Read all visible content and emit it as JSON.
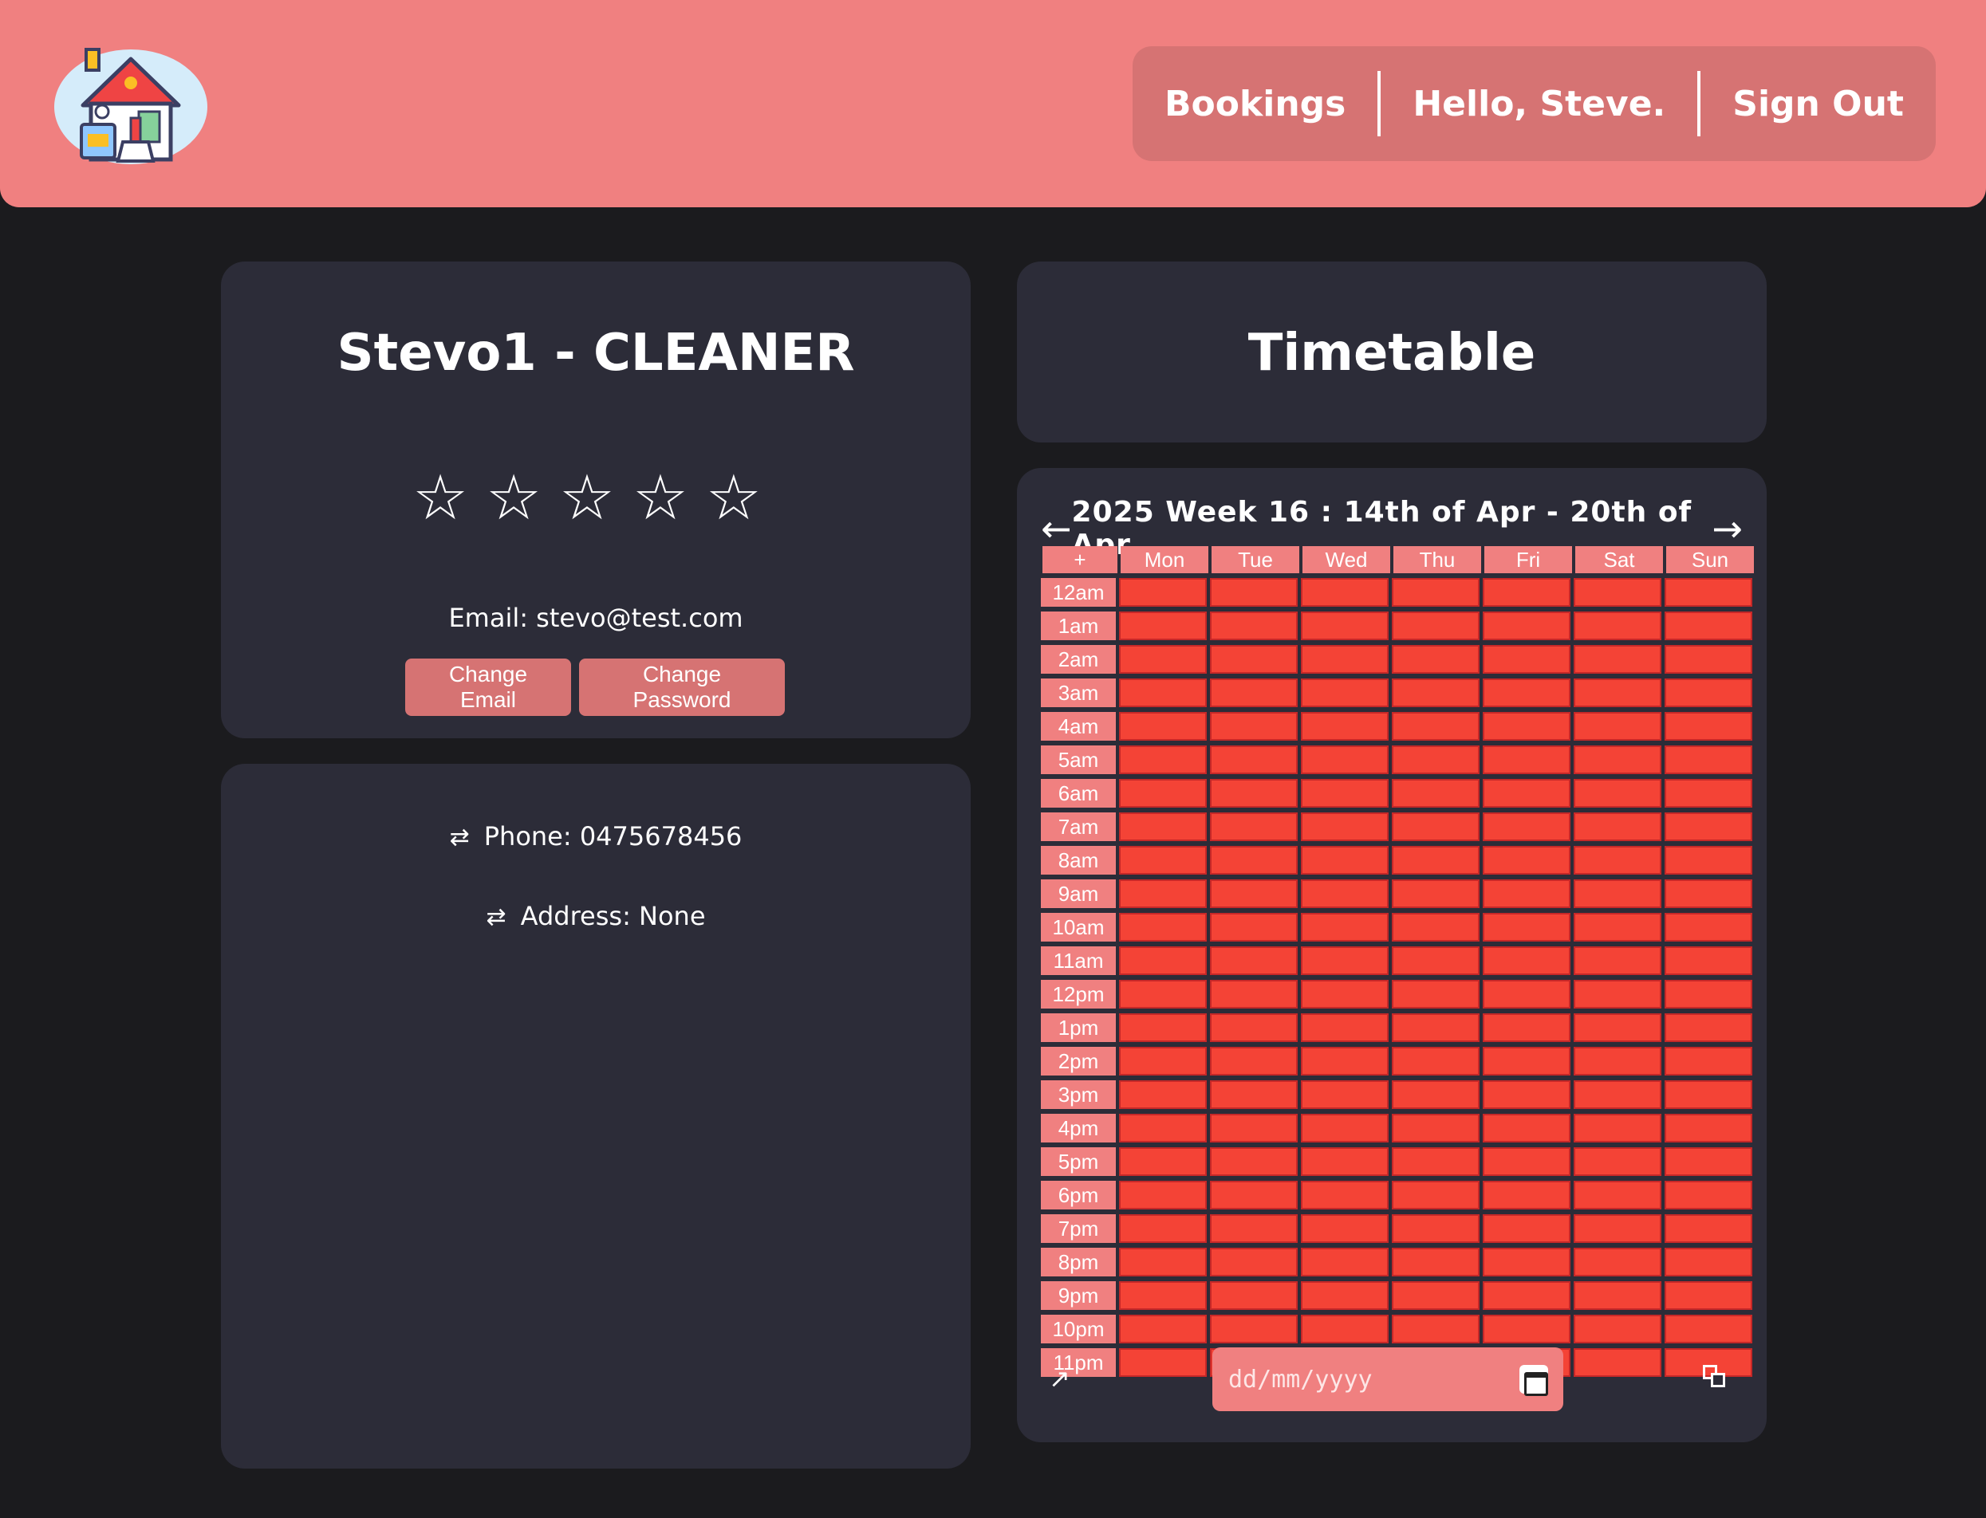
{
  "header": {
    "logo_icon": "house-cleaning-logo-icon",
    "nav": {
      "bookings": "Bookings",
      "greeting": "Hello, Steve.",
      "sign_out": "Sign Out"
    }
  },
  "profile": {
    "title": "Stevo1 - CLEANER",
    "stars": "☆☆☆☆☆",
    "rating": 0,
    "email_line": "Email: stevo@test.com",
    "change_email": "Change Email",
    "change_password": "Change Password"
  },
  "details": {
    "swap_icon": "⇄",
    "phone_line": "Phone: 0475678456",
    "address_line": "Address: None"
  },
  "timetable": {
    "title": "Timetable",
    "prev": "←",
    "next": "→",
    "week_label": "2025  Week  16  :  14th of Apr - 20th of Apr",
    "add_symbol": "+",
    "days": [
      "Mon",
      "Tue",
      "Wed",
      "Thu",
      "Fri",
      "Sat",
      "Sun"
    ],
    "hours": [
      "12am",
      "1am",
      "2am",
      "3am",
      "4am",
      "5am",
      "6am",
      "7am",
      "8am",
      "9am",
      "10am",
      "11am",
      "12pm",
      "1pm",
      "2pm",
      "3pm",
      "4pm",
      "5pm",
      "6pm",
      "7pm",
      "8pm",
      "9pm",
      "10pm",
      "11pm"
    ],
    "expand_symbol": "↗",
    "date_placeholder": "dd/mm/yyyy"
  },
  "colors": {
    "header_bg": "#f08080",
    "nav_bg": "#d67373",
    "page_bg": "#1b1b1e",
    "panel_bg": "#2c2c38",
    "slot_cell": "#f44336"
  }
}
